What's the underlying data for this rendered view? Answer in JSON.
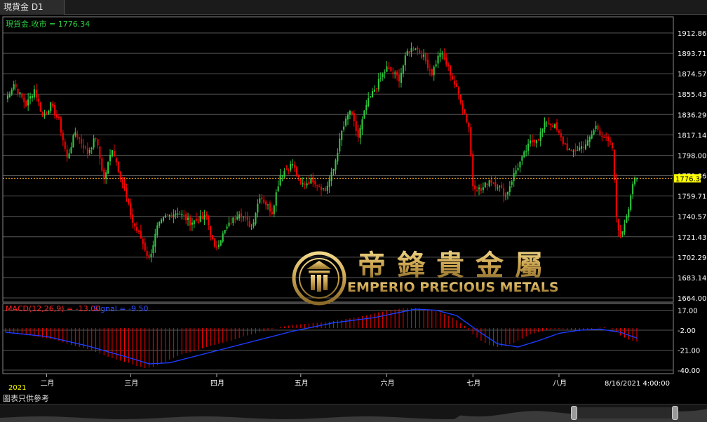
{
  "tab": {
    "title": "現貨金 D1"
  },
  "main_panel": {
    "label": "現貨金.收市 = 1776.34",
    "label_color": "#2ecc40"
  },
  "macd_panel": {
    "label": "MACD(12,26,9) = -13.00",
    "signal_label": "Signal = -9.50",
    "yticks": [
      "17.00",
      "-2.00",
      "-21.00",
      "-40.00"
    ],
    "ylim": [
      -42,
      20
    ]
  },
  "watermark": {
    "chinese": "帝鋒貴金屬",
    "english": "EMPERIO PRECIOUS METALS",
    "color": "#c9a24e"
  },
  "time_axis": {
    "year_label": "2021",
    "months": [
      "二月",
      "三月",
      "四月",
      "五月",
      "六月",
      "七月",
      "八月"
    ],
    "timestamp": "8/16/2021 4:00:00"
  },
  "footer": {
    "note": "圖表只供參考"
  },
  "colors": {
    "up": "#2ecc40",
    "down": "#ff0000",
    "macd_hist": "#ff0000",
    "signal": "#1e3cff",
    "last_price": "#ffff00"
  },
  "chart_data": [
    {
      "type": "candlestick",
      "title": "現貨金 D1",
      "series_label": "現貨金.收市",
      "last_close": 1776.34,
      "ylim": [
        1664.0,
        1912.86
      ],
      "yticks": [
        1912.86,
        1893.71,
        1874.57,
        1855.43,
        1836.29,
        1817.14,
        1798.0,
        1778.86,
        1759.71,
        1740.57,
        1721.43,
        1702.29,
        1683.14,
        1664.0
      ],
      "last_price_label": "1776.34",
      "grid": true,
      "x_labels": [
        "二月",
        "三月",
        "四月",
        "五月",
        "六月",
        "七月",
        "八月"
      ],
      "keyframes_close": [
        [
          0,
          1850
        ],
        [
          4,
          1865
        ],
        [
          10,
          1845
        ],
        [
          14,
          1860
        ],
        [
          18,
          1835
        ],
        [
          22,
          1845
        ],
        [
          26,
          1830
        ],
        [
          30,
          1795
        ],
        [
          34,
          1820
        ],
        [
          40,
          1800
        ],
        [
          44,
          1815
        ],
        [
          48,
          1775
        ],
        [
          52,
          1805
        ],
        [
          58,
          1765
        ],
        [
          62,
          1735
        ],
        [
          66,
          1720
        ],
        [
          70,
          1700
        ],
        [
          74,
          1730
        ],
        [
          78,
          1740
        ],
        [
          84,
          1745
        ],
        [
          90,
          1735
        ],
        [
          98,
          1740
        ],
        [
          102,
          1710
        ],
        [
          108,
          1730
        ],
        [
          114,
          1745
        ],
        [
          120,
          1730
        ],
        [
          124,
          1760
        ],
        [
          130,
          1745
        ],
        [
          134,
          1780
        ],
        [
          140,
          1790
        ],
        [
          144,
          1770
        ],
        [
          150,
          1775
        ],
        [
          156,
          1765
        ],
        [
          160,
          1785
        ],
        [
          164,
          1820
        ],
        [
          168,
          1840
        ],
        [
          172,
          1815
        ],
        [
          176,
          1845
        ],
        [
          180,
          1860
        ],
        [
          186,
          1880
        ],
        [
          192,
          1870
        ],
        [
          196,
          1895
        ],
        [
          200,
          1900
        ],
        [
          204,
          1890
        ],
        [
          208,
          1875
        ],
        [
          212,
          1895
        ],
        [
          216,
          1880
        ],
        [
          222,
          1850
        ],
        [
          226,
          1825
        ],
        [
          228,
          1770
        ],
        [
          232,
          1765
        ],
        [
          236,
          1775
        ],
        [
          240,
          1770
        ],
        [
          244,
          1760
        ],
        [
          248,
          1780
        ],
        [
          252,
          1795
        ],
        [
          256,
          1810
        ],
        [
          260,
          1815
        ],
        [
          264,
          1830
        ],
        [
          268,
          1825
        ],
        [
          272,
          1810
        ],
        [
          276,
          1800
        ],
        [
          280,
          1805
        ],
        [
          284,
          1810
        ],
        [
          288,
          1825
        ],
        [
          292,
          1815
        ],
        [
          296,
          1805
        ],
        [
          298,
          1740
        ],
        [
          300,
          1720
        ],
        [
          304,
          1750
        ],
        [
          306,
          1772
        ],
        [
          308,
          1776
        ]
      ]
    },
    {
      "type": "macd",
      "title": "MACD(12,26,9)",
      "value": -13.0,
      "signal": -9.5,
      "ylim": [
        -42,
        20
      ],
      "yticks": [
        17.0,
        -2.0,
        -21.0,
        -40.0
      ],
      "keyframes_hist": [
        [
          0,
          -4
        ],
        [
          6,
          -5
        ],
        [
          12,
          -7
        ],
        [
          18,
          -9
        ],
        [
          24,
          -11
        ],
        [
          30,
          -15
        ],
        [
          36,
          -18
        ],
        [
          42,
          -21
        ],
        [
          48,
          -26
        ],
        [
          54,
          -30
        ],
        [
          60,
          -33
        ],
        [
          64,
          -36
        ],
        [
          68,
          -38
        ],
        [
          72,
          -37
        ],
        [
          76,
          -34
        ],
        [
          80,
          -30
        ],
        [
          86,
          -25
        ],
        [
          92,
          -22
        ],
        [
          98,
          -18
        ],
        [
          104,
          -15
        ],
        [
          110,
          -12
        ],
        [
          116,
          -8
        ],
        [
          122,
          -5
        ],
        [
          128,
          -2
        ],
        [
          134,
          1
        ],
        [
          140,
          3
        ],
        [
          146,
          4
        ],
        [
          152,
          5
        ],
        [
          158,
          6
        ],
        [
          164,
          8
        ],
        [
          170,
          10
        ],
        [
          176,
          12
        ],
        [
          182,
          15
        ],
        [
          188,
          17
        ],
        [
          194,
          19
        ],
        [
          200,
          19
        ],
        [
          206,
          18
        ],
        [
          212,
          15
        ],
        [
          218,
          10
        ],
        [
          224,
          2
        ],
        [
          228,
          -6
        ],
        [
          232,
          -12
        ],
        [
          236,
          -16
        ],
        [
          240,
          -18
        ],
        [
          244,
          -17
        ],
        [
          248,
          -14
        ],
        [
          252,
          -10
        ],
        [
          256,
          -6
        ],
        [
          260,
          -4
        ],
        [
          264,
          -2
        ],
        [
          268,
          -1
        ],
        [
          272,
          -1
        ],
        [
          276,
          -2
        ],
        [
          280,
          -3
        ],
        [
          284,
          -2
        ],
        [
          288,
          0
        ],
        [
          292,
          1
        ],
        [
          296,
          -1
        ],
        [
          300,
          -7
        ],
        [
          304,
          -11
        ],
        [
          308,
          -13
        ]
      ],
      "keyframes_signal": [
        [
          0,
          -4
        ],
        [
          20,
          -8
        ],
        [
          40,
          -17
        ],
        [
          60,
          -28
        ],
        [
          70,
          -34
        ],
        [
          80,
          -33
        ],
        [
          100,
          -23
        ],
        [
          120,
          -13
        ],
        [
          140,
          -3
        ],
        [
          160,
          5
        ],
        [
          180,
          10
        ],
        [
          200,
          18
        ],
        [
          210,
          17
        ],
        [
          220,
          12
        ],
        [
          230,
          -2
        ],
        [
          240,
          -15
        ],
        [
          250,
          -18
        ],
        [
          260,
          -12
        ],
        [
          270,
          -5
        ],
        [
          280,
          -2
        ],
        [
          290,
          -1
        ],
        [
          300,
          -4
        ],
        [
          308,
          -9.5
        ]
      ]
    }
  ]
}
